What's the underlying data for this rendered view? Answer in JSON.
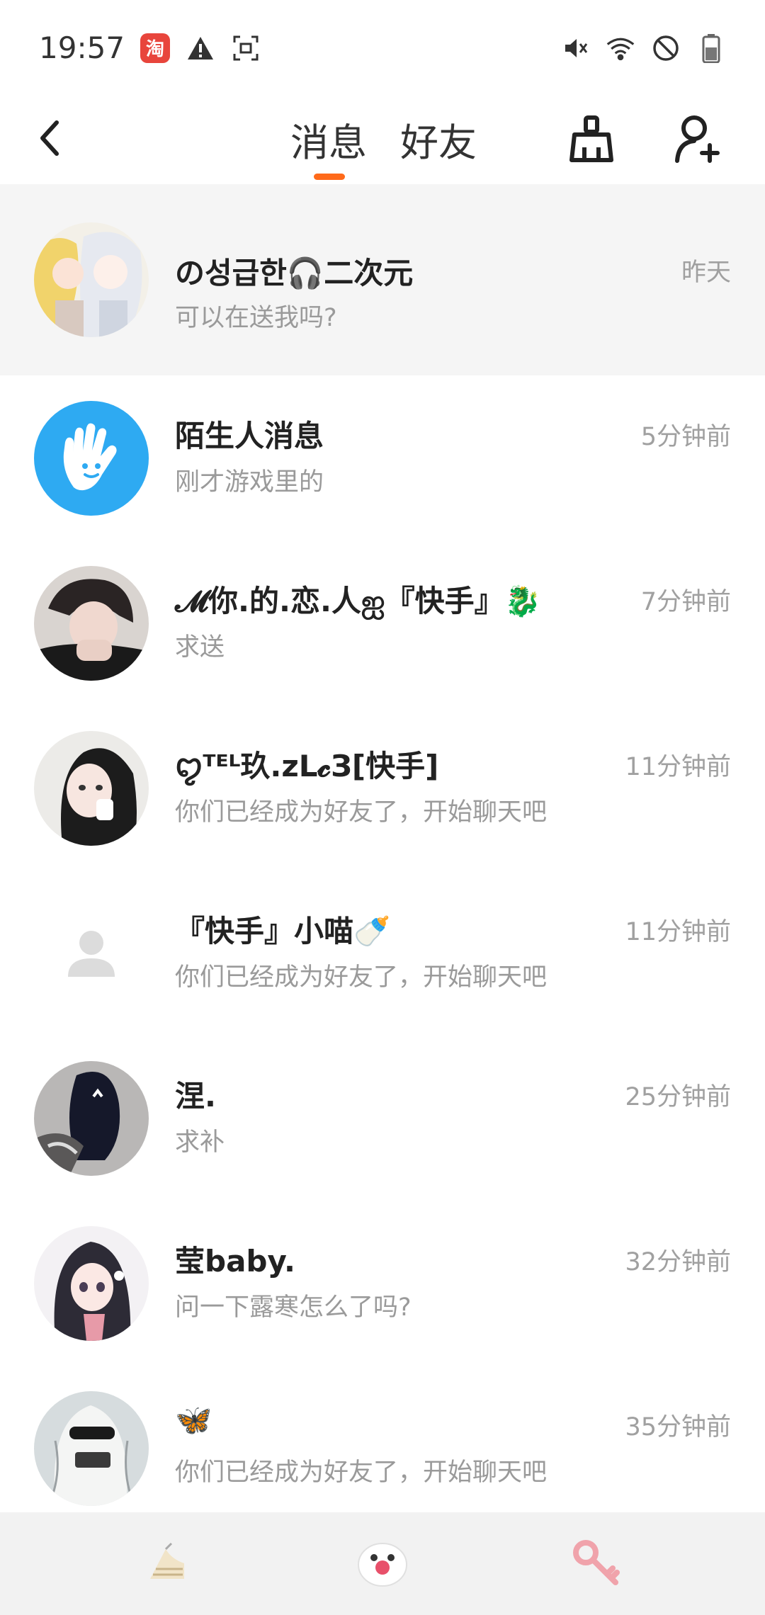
{
  "status_bar": {
    "time": "19:57",
    "taobao_badge": "淘"
  },
  "header": {
    "tab_messages": "消息",
    "tab_friends": "好友",
    "accent": "#ff6a1a"
  },
  "conversations": [
    {
      "name": "の성급한🎧二次元",
      "preview": "可以在送我吗?",
      "time": "昨天",
      "avatar": "anime-duo",
      "pinned": true
    },
    {
      "name": "陌生人消息",
      "preview": "刚才游戏里的",
      "time": "5分钟前",
      "avatar": "hand-icon"
    },
    {
      "name": "𝓜你.的.恋.人ஐ『快手』🐉",
      "preview": "求送",
      "time": "7分钟前",
      "avatar": "photo-dark"
    },
    {
      "name": "ꨄᵀᴱᴸ玖.zL𝓬З[快手]",
      "preview": "你们已经成为好友了，开始聊天吧",
      "time": "11分钟前",
      "avatar": "photo-girl"
    },
    {
      "name": "『快手』小喵🍼",
      "preview": "你们已经成为好友了，开始聊天吧",
      "time": "11分钟前",
      "avatar": "default-user"
    },
    {
      "name": "涅.",
      "preview": "求补",
      "time": "25分钟前",
      "avatar": "photo-hood"
    },
    {
      "name": "莹baby.",
      "preview": "问一下露寒怎么了吗?",
      "time": "32分钟前",
      "avatar": "anime-girl"
    },
    {
      "name": "🦋",
      "preview": "你们已经成为好友了，开始聊天吧",
      "time": "35分钟前",
      "avatar": "photo-sketch"
    }
  ]
}
